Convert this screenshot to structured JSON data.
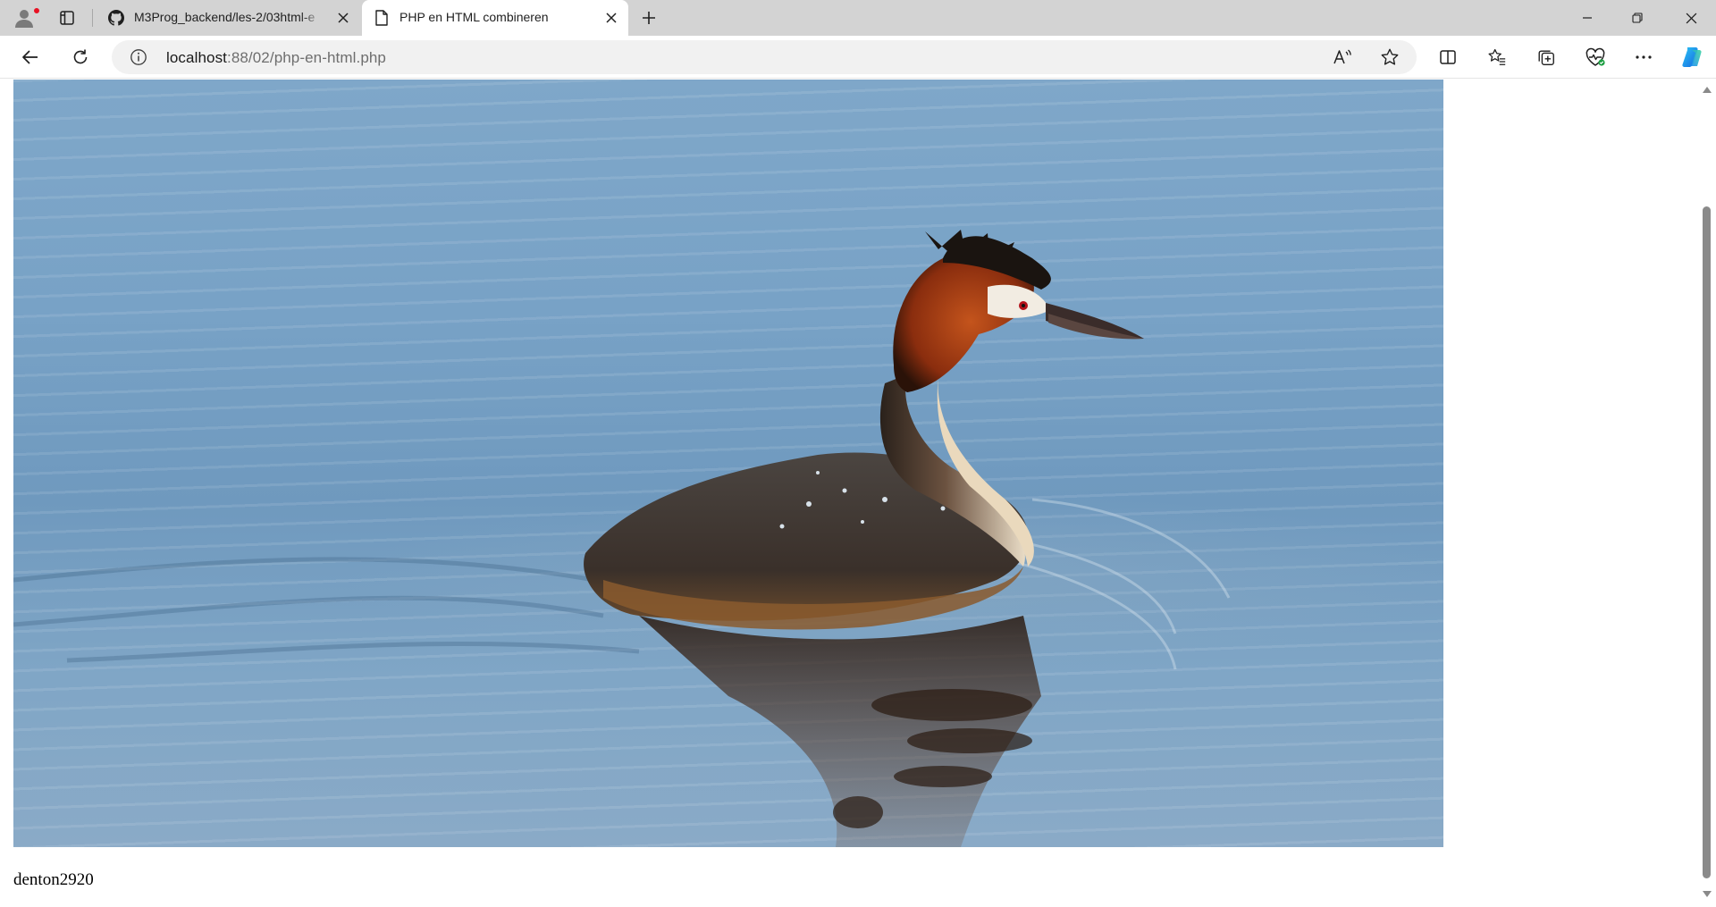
{
  "browser": {
    "tabs": [
      {
        "title": "M3Prog_backend/les-2/03html-e",
        "icon": "github-icon",
        "active": false
      },
      {
        "title": "PHP en HTML combineren",
        "icon": "page-icon",
        "active": true
      }
    ],
    "address": {
      "host": "localhost",
      "path": ":88/02/php-en-html.php"
    },
    "colors": {
      "tabstrip": "#d3d3d3",
      "address_bg": "#f1f1f1",
      "profile_badge": "#e81123",
      "copilot": "#1b8ef2"
    },
    "icons": {
      "profile": "profile-icon",
      "tab_actions": "tab-actions-icon",
      "new_tab": "plus-icon",
      "back": "back-arrow-icon",
      "reload": "reload-icon",
      "site_info": "info-icon",
      "read_aloud": "read-aloud-icon",
      "favorite": "star-icon",
      "split_screen": "split-screen-icon",
      "favorites": "favorites-icon",
      "collections": "collections-icon",
      "browser_essentials": "heart-pulse-icon",
      "more": "more-icon",
      "copilot": "copilot-icon"
    }
  },
  "page": {
    "image": {
      "subject": "great-crested-grebe-on-water"
    },
    "caption": "denton2920"
  }
}
